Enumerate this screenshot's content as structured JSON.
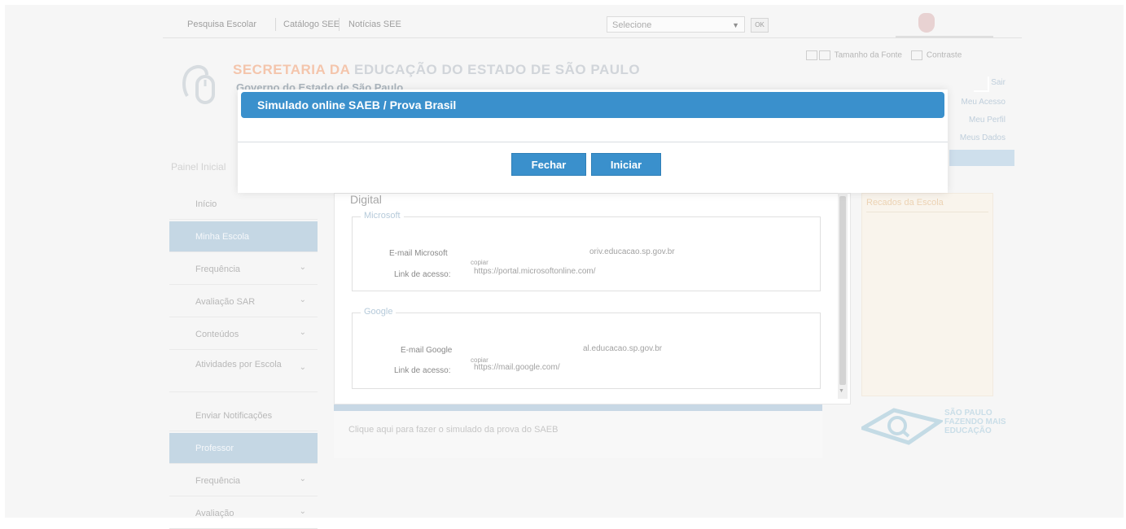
{
  "topbar": {
    "links": [
      "Pesquisa Escolar",
      "Catálogo SEE",
      "Notícias SEE"
    ],
    "select_value": "Selecione",
    "go_label": "OK"
  },
  "header": {
    "brand_part1": "SECRETARIA DA",
    "brand_part2": "EDUCAÇÃO DO ESTADO DE SÃO PAULO",
    "brand_sub": "Governo do Estado de São Paulo",
    "tools": [
      "Tamanho da Fonte",
      "Contraste"
    ],
    "right_links": [
      "Sair",
      "Meu Acesso",
      "Meu Perfil",
      "Meus Dados"
    ],
    "left_title": "Painel Inicial"
  },
  "sidebar": {
    "items": [
      {
        "label": "Início",
        "active": false,
        "chevron": false
      },
      {
        "label": "Minha Escola",
        "active": true,
        "chevron": false
      },
      {
        "label": "Frequência",
        "active": false,
        "chevron": true
      },
      {
        "label": "Avaliação SAR",
        "active": false,
        "chevron": true
      },
      {
        "label": "Conteúdos",
        "active": false,
        "chevron": true
      },
      {
        "label": "Atividades por Escola",
        "active": false,
        "chevron": true
      },
      {
        "label": "Enviar Notificações",
        "active": false,
        "chevron": false
      },
      {
        "label": "Professor",
        "active": true,
        "chevron": false
      },
      {
        "label": "Frequência",
        "active": false,
        "chevron": true
      },
      {
        "label": "Avaliação",
        "active": false,
        "chevron": true
      }
    ]
  },
  "content": {
    "section_title": "Digital",
    "microsoft": {
      "legend": "Microsoft",
      "email_label": "E-mail Microsoft",
      "email_value": "oriv.educacao.sp.gov.br",
      "link_label": "Link de acesso:",
      "link_value": "https://portal.microsoftonline.com/",
      "hint": "copiar"
    },
    "google": {
      "legend": "Google",
      "email_label": "E-mail Google",
      "email_value": "al.educacao.sp.gov.br",
      "link_label": "Link de acesso:",
      "link_value": "https://mail.google.com/",
      "hint": "copiar"
    },
    "footer_text": "Clique aqui para fazer o simulado da prova do SAEB"
  },
  "side_panel": {
    "title": "Recados da Escola"
  },
  "side_logo_text": "SÃO PAULO FAZENDO MAIS EDUCAÇÃO",
  "modal": {
    "title": "Simulado online SAEB / Prova Brasil",
    "close_label": "Fechar",
    "start_label": "Iniciar"
  },
  "colors": {
    "modal_header": "#3a90cc",
    "button": "#3a90cc",
    "sidebar_active": "#b9cfdf"
  }
}
